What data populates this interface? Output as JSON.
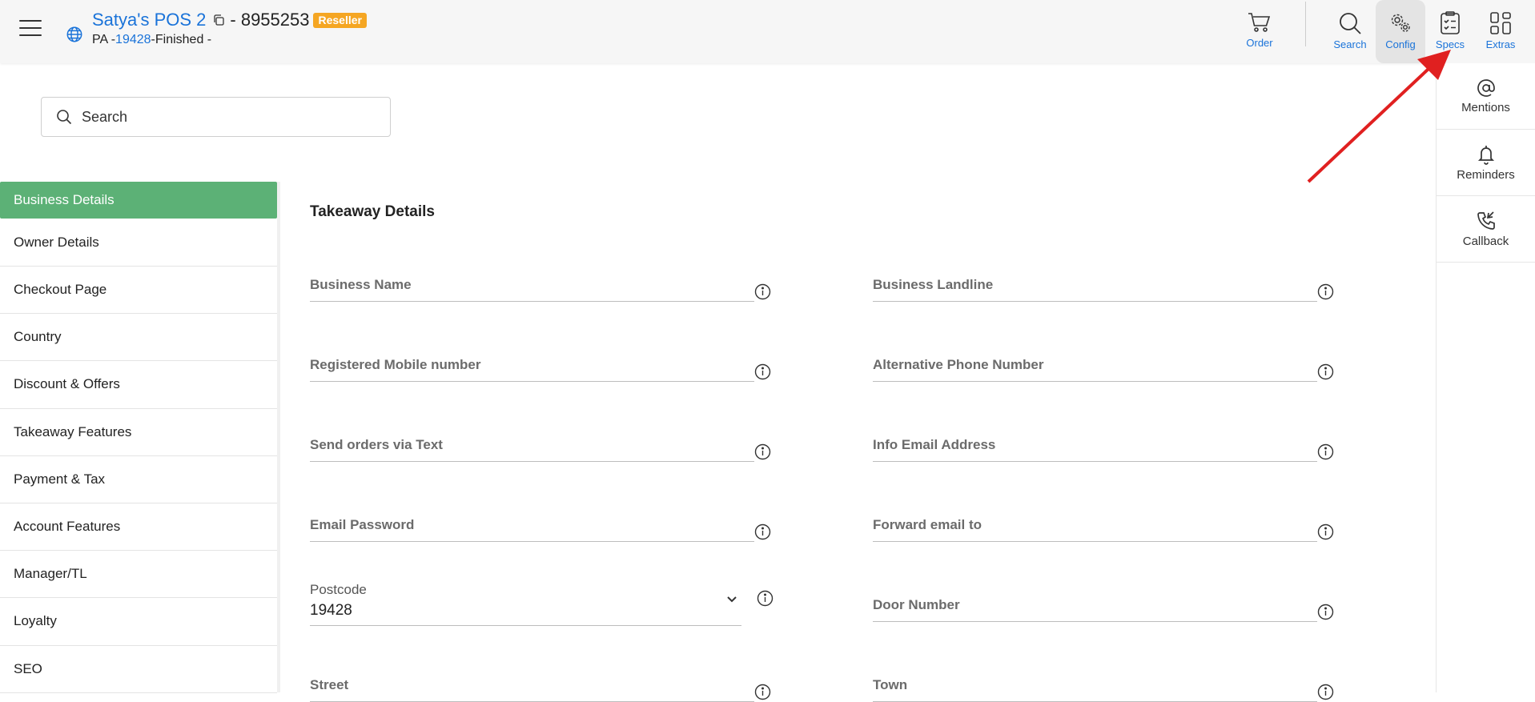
{
  "header": {
    "title": "Satya's POS 2",
    "phone": "- 8955253",
    "badge": "Reseller",
    "sub_prefix": "PA -",
    "sub_id": "19428",
    "sub_status": "-Finished -",
    "buttons": {
      "order": "Order",
      "search": "Search",
      "config": "Config",
      "specs": "Specs",
      "extras": "Extras"
    }
  },
  "rail": {
    "mentions": "Mentions",
    "reminders": "Reminders",
    "callback": "Callback"
  },
  "search": {
    "placeholder": "Search"
  },
  "sidebar": {
    "items": [
      "Business Details",
      "Owner Details",
      "Checkout Page",
      "Country",
      "Discount & Offers",
      "Takeaway Features",
      "Payment & Tax",
      "Account Features",
      "Manager/TL",
      "Loyalty",
      "SEO"
    ],
    "active": "Business Details"
  },
  "main": {
    "section_title": "Takeaway Details",
    "fields": {
      "business_name": "Business Name",
      "business_landline": "Business Landline",
      "registered_mobile": "Registered Mobile number",
      "alternative_phone": "Alternative Phone Number",
      "send_orders_text": "Send orders via Text",
      "info_email": "Info Email Address",
      "email_password": "Email Password",
      "forward_email": "Forward email to",
      "door_number": "Door Number",
      "street": "Street",
      "town": "Town"
    },
    "postcode": {
      "label": "Postcode",
      "value": "19428"
    }
  },
  "colors": {
    "accent": "#1a73d9",
    "active_nav": "#5cb176",
    "badge": "#f5a623",
    "annotation_arrow": "#e02020"
  }
}
